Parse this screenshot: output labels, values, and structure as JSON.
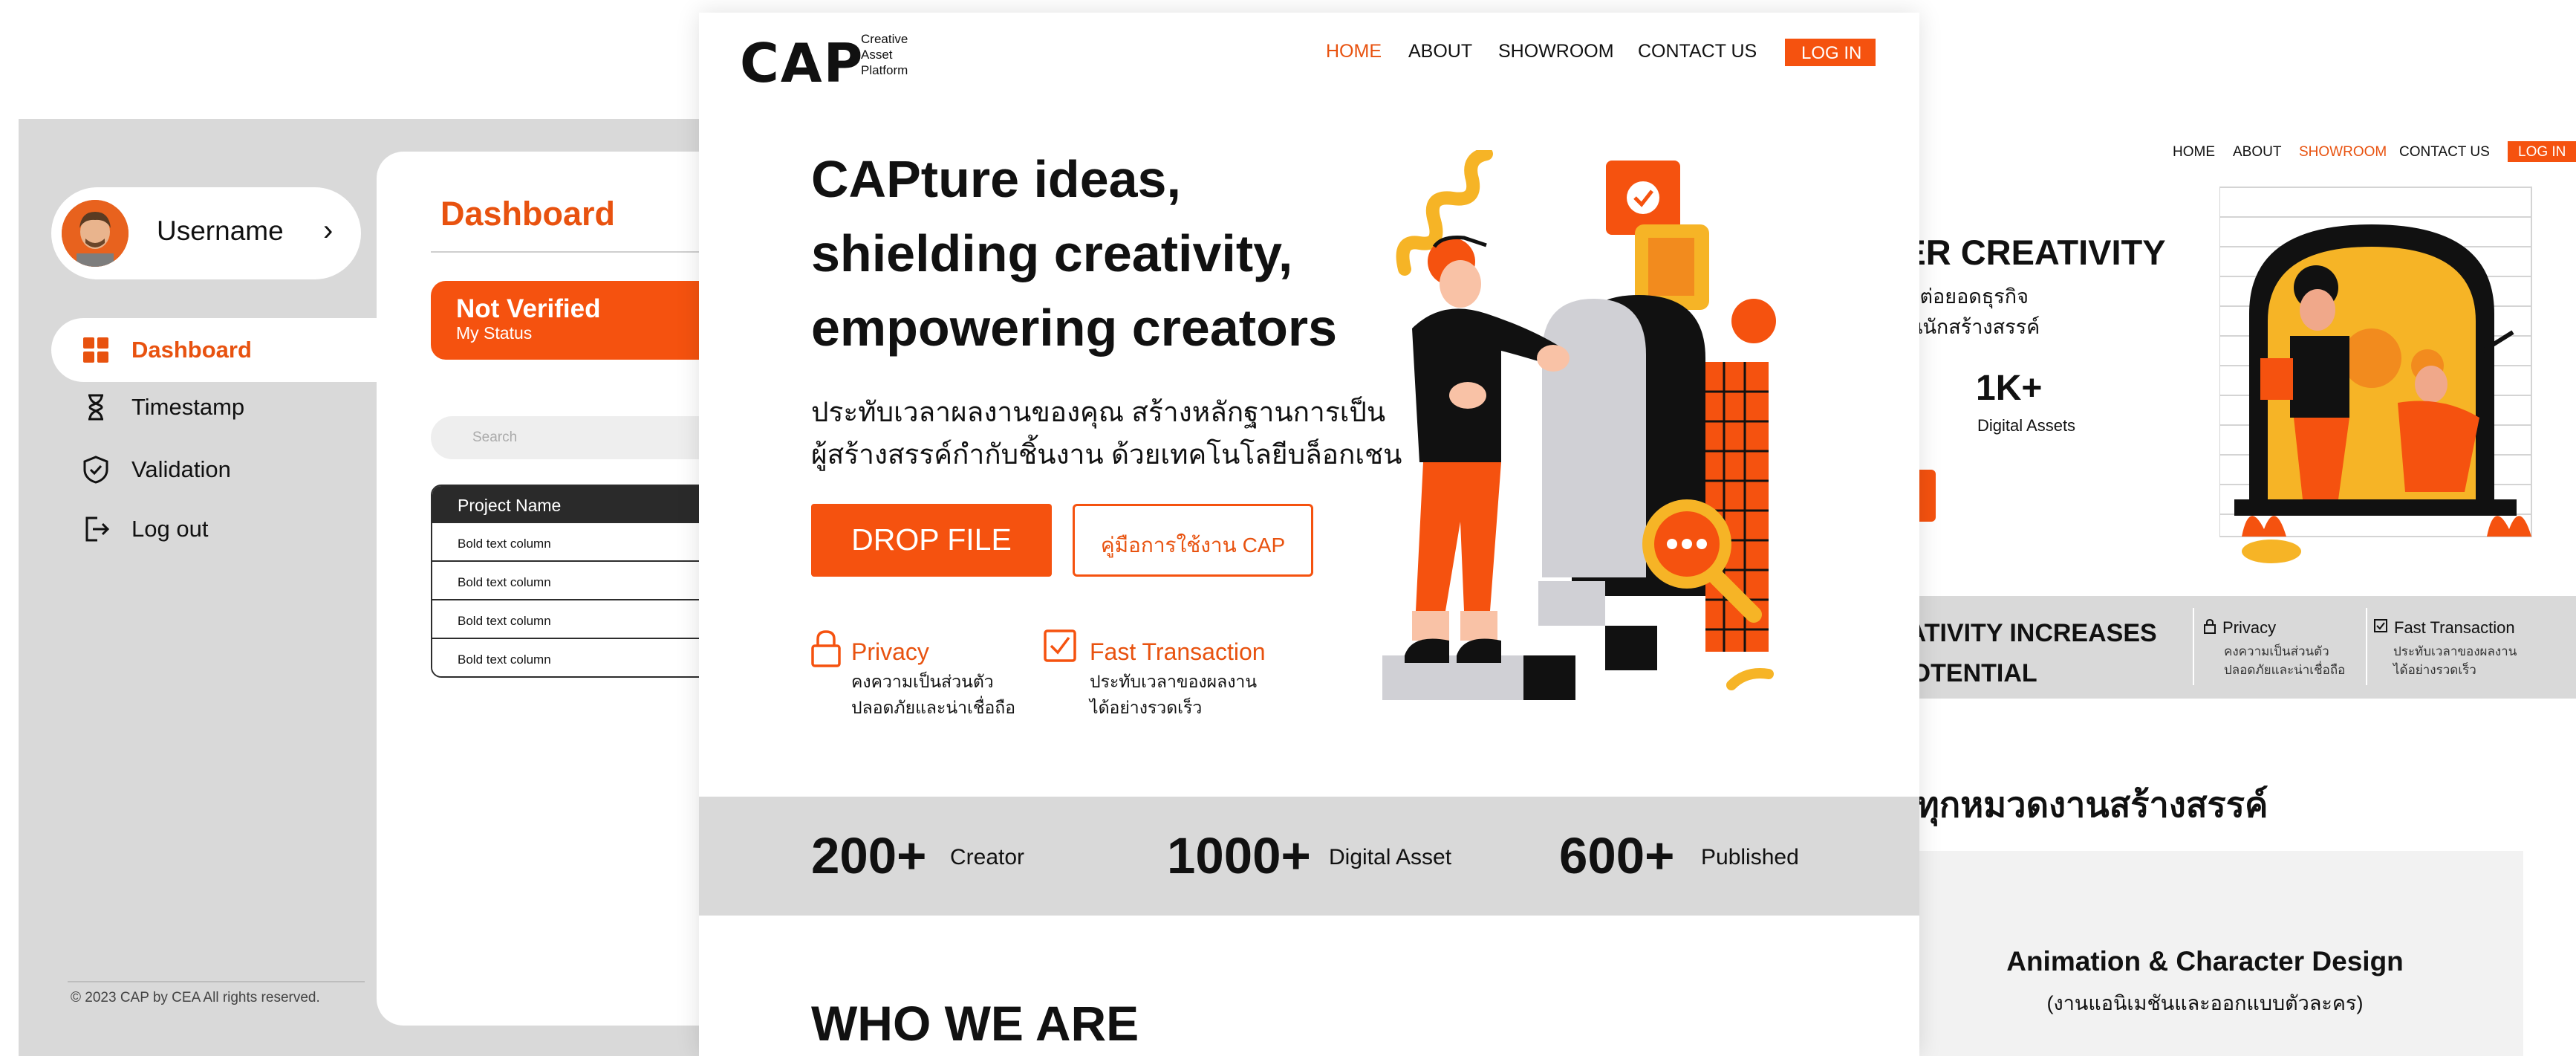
{
  "dashboard": {
    "username": "Username",
    "chevron": "›",
    "nav": [
      {
        "label": "Dashboard",
        "icon": "grid-icon"
      },
      {
        "label": "Timestamp",
        "icon": "hourglass-icon"
      },
      {
        "label": "Validation",
        "icon": "shield-check-icon"
      },
      {
        "label": "Log out",
        "icon": "logout-icon"
      }
    ],
    "footer": "© 2023  CAP by CEA All rights reserved.",
    "title": "Dashboard",
    "status": {
      "title": "Not Verified",
      "subtitle": "My Status"
    },
    "search_placeholder": "Search",
    "table": {
      "header": "Project Name",
      "rows": [
        "Bold text column",
        "Bold text column",
        "Bold text column",
        "Bold text column"
      ]
    }
  },
  "home": {
    "logo": {
      "mark": "CAP",
      "line1": "Creative",
      "line2": "Asset",
      "line3": "Platform"
    },
    "nav": {
      "home": "HOME",
      "about": "ABOUT",
      "showroom": "SHOWROOM",
      "contact": "CONTACT US",
      "login": "LOG IN"
    },
    "headline": [
      "CAPture ideas,",
      "shielding creativity,",
      "empowering creators"
    ],
    "subtitle": [
      "ประทับเวลาผลงานของคุณ สร้างหลักฐานการเป็น",
      "ผู้สร้างสรรค์กำกับชิ้นงาน ด้วยเทคโนโลยีบล็อกเชน"
    ],
    "drop_button": "DROP FILE",
    "guide_button": "คู่มือการใช้งาน CAP",
    "features": [
      {
        "title": "Privacy",
        "line1": "คงความเป็นส่วนตัว",
        "line2": "ปลอดภัยและน่าเชื่อถือ",
        "icon": "lock-icon"
      },
      {
        "title": "Fast Transaction",
        "line1": "ประทับเวลาของผลงาน",
        "line2": "ได้อย่างรวดเร็ว",
        "icon": "checkbox-icon"
      }
    ],
    "stats": [
      {
        "value": "200+",
        "label": "Creator"
      },
      {
        "value": "1000+",
        "label": "Digital Asset"
      },
      {
        "value": "600+",
        "label": "Published"
      }
    ],
    "who_heading": "WHO WE ARE",
    "accent_color": "#f5520f"
  },
  "showroom": {
    "nav": {
      "home": "HOME",
      "about": "ABOUT",
      "showroom": "SHOWROOM",
      "contact": "CONTACT US",
      "login": "LOG IN"
    },
    "headline": "VER CREATIVITY",
    "sub1": "รต่อยอดธุรกิจ",
    "sub2": "ันนักสร้างสรรค์",
    "stat_value": "1K+",
    "stat_label": "Digital Assets",
    "band_line1": "EATIVITY INCREASES",
    "band_line2": "POTENTIAL",
    "features": [
      {
        "title": "Privacy",
        "line1": "คงความเป็นส่วนตัว",
        "line2": "ปลอดภัยและน่าเชื่อถือ"
      },
      {
        "title": "Fast Transaction",
        "line1": "ประทับเวลาของผลงาน",
        "line2": "ได้อย่างรวดเร็ว"
      }
    ],
    "category_heading": "ลุมทุกหมวดงานสร้างสรรค์",
    "card_title": "Animation & Character Design",
    "card_subtitle": "(งานแอนิเมชันและออกแบบตัวละคร)"
  }
}
